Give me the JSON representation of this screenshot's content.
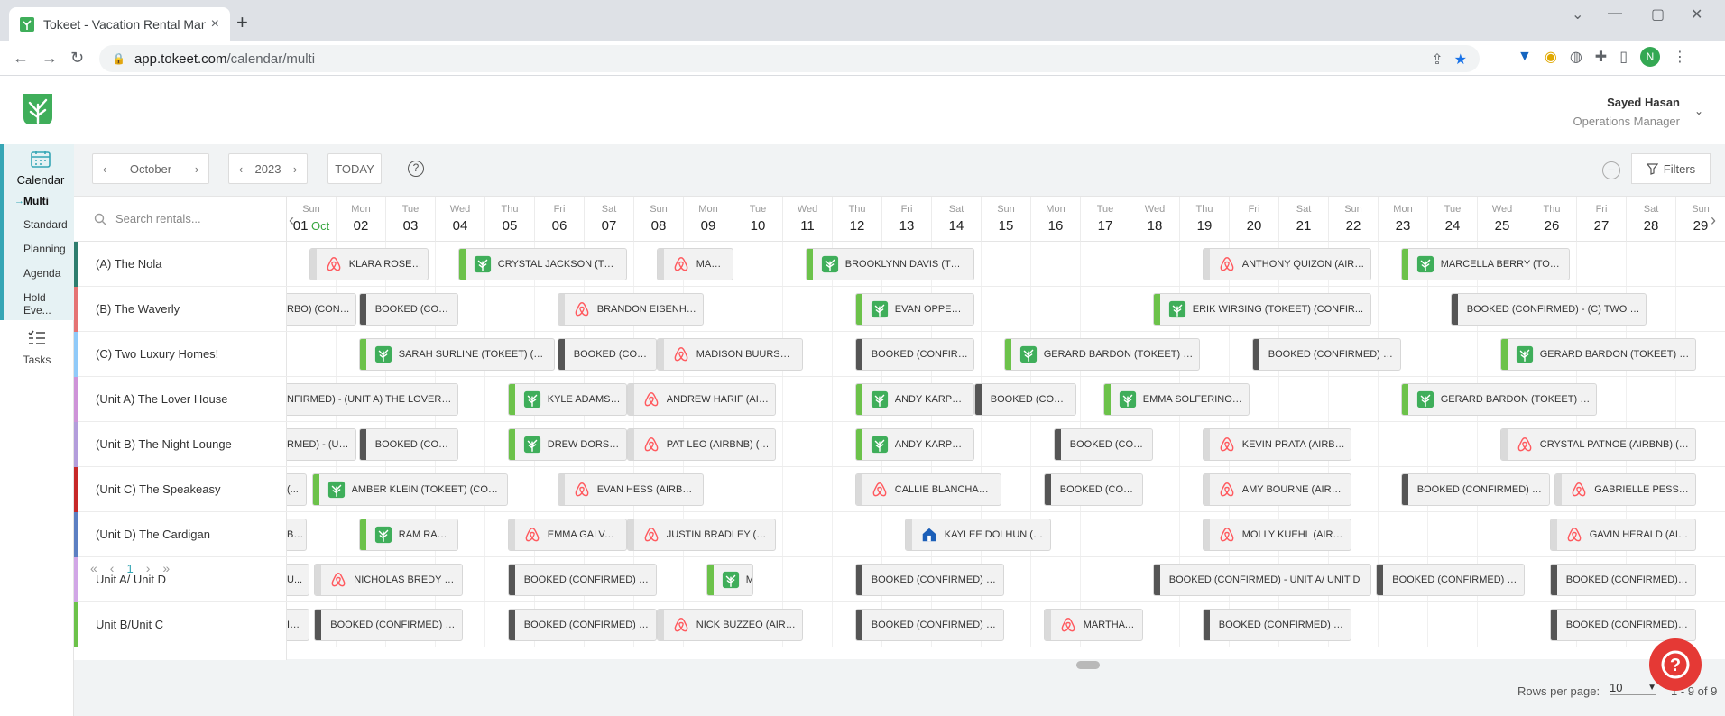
{
  "browser": {
    "tab_title": "Tokeet - Vacation Rental Manage",
    "tab_close": "×",
    "new_tab": "+",
    "url_host": "app.tokeet.com",
    "url_path": "/calendar/multi",
    "profile_initial": "N"
  },
  "header": {
    "user_name": "Sayed Hasan",
    "user_role": "Operations Manager"
  },
  "sidenav": {
    "calendar_label": "Calendar",
    "sub_items": [
      "Multi",
      "Standard",
      "Planning",
      "Agenda",
      "Hold Eve..."
    ],
    "tasks_label": "Tasks"
  },
  "toolbar": {
    "month": "October",
    "year": "2023",
    "today": "TODAY",
    "help": "?",
    "filters": "Filters"
  },
  "search": {
    "placeholder": "Search rentals..."
  },
  "days": [
    {
      "wd": "Sun",
      "dn": "01",
      "mo": "Oct"
    },
    {
      "wd": "Mon",
      "dn": "02"
    },
    {
      "wd": "Tue",
      "dn": "03"
    },
    {
      "wd": "Wed",
      "dn": "04"
    },
    {
      "wd": "Thu",
      "dn": "05"
    },
    {
      "wd": "Fri",
      "dn": "06"
    },
    {
      "wd": "Sat",
      "dn": "07"
    },
    {
      "wd": "Sun",
      "dn": "08"
    },
    {
      "wd": "Mon",
      "dn": "09"
    },
    {
      "wd": "Tue",
      "dn": "10"
    },
    {
      "wd": "Wed",
      "dn": "11"
    },
    {
      "wd": "Thu",
      "dn": "12"
    },
    {
      "wd": "Fri",
      "dn": "13"
    },
    {
      "wd": "Sat",
      "dn": "14"
    },
    {
      "wd": "Sun",
      "dn": "15"
    },
    {
      "wd": "Mon",
      "dn": "16"
    },
    {
      "wd": "Tue",
      "dn": "17"
    },
    {
      "wd": "Wed",
      "dn": "18"
    },
    {
      "wd": "Thu",
      "dn": "19"
    },
    {
      "wd": "Fri",
      "dn": "20"
    },
    {
      "wd": "Sat",
      "dn": "21"
    },
    {
      "wd": "Sun",
      "dn": "22"
    },
    {
      "wd": "Mon",
      "dn": "23"
    },
    {
      "wd": "Tue",
      "dn": "24"
    },
    {
      "wd": "Wed",
      "dn": "25"
    },
    {
      "wd": "Thu",
      "dn": "26"
    },
    {
      "wd": "Fri",
      "dn": "27"
    },
    {
      "wd": "Sat",
      "dn": "28"
    },
    {
      "wd": "Sun",
      "dn": "29"
    }
  ],
  "rentals": [
    {
      "name": "(A) The Nola",
      "color": "#2e7d6e"
    },
    {
      "name": "(B) The Waverly",
      "color": "#e57373"
    },
    {
      "name": "(C) Two Luxury Homes!",
      "color": "#90caf9"
    },
    {
      "name": "(Unit A) The Lover House",
      "color": "#ce93d8"
    },
    {
      "name": "(Unit B) The Night Lounge",
      "color": "#b39ddb"
    },
    {
      "name": "(Unit C) The Speakeasy",
      "color": "#c62828"
    },
    {
      "name": "(Unit D) The Cardigan",
      "color": "#5c7fc2"
    },
    {
      "name": "Unit A/ Unit D",
      "color": "#d1a6e6"
    },
    {
      "name": "Unit B/Unit C",
      "color": "#6cc24a"
    }
  ],
  "bookings": [
    [
      {
        "start": 0.45,
        "end": 2.85,
        "src": "airbnb",
        "text": "KLARA ROSENBERG (..."
      },
      {
        "start": 3.45,
        "end": 6.85,
        "src": "tokeet",
        "text": "CRYSTAL JACKSON (TOKEET) (C..."
      },
      {
        "start": 7.45,
        "end": 9.0,
        "src": "airbnb",
        "text": "MARTHA B..."
      },
      {
        "start": 10.45,
        "end": 13.85,
        "src": "tokeet",
        "text": "BROOKLYNN DAVIS (TOKEET) (C..."
      },
      {
        "start": 18.45,
        "end": 21.85,
        "src": "airbnb",
        "text": "ANTHONY QUIZON (AIRBNB) (CO..."
      },
      {
        "start": 22.45,
        "end": 25.85,
        "src": "tokeet",
        "text": "MARCELLA BERRY (TOKEET) (CO..."
      }
    ],
    [
      {
        "start": -0.2,
        "end": 1.4,
        "src": "none",
        "edge": "none",
        "text": "RBO) (CONFI..."
      },
      {
        "start": 1.45,
        "end": 3.45,
        "src": "none",
        "edge": "dark",
        "text": "BOOKED (CONFI..."
      },
      {
        "start": 5.45,
        "end": 8.4,
        "src": "airbnb",
        "text": "BRANDON EISENHAR..."
      },
      {
        "start": 11.45,
        "end": 13.85,
        "src": "tokeet",
        "text": "EVAN OPPENHEIMER ..."
      },
      {
        "start": 17.45,
        "end": 21.85,
        "src": "tokeet",
        "text": "ERIK WIRSING (TOKEET) (CONFIR..."
      },
      {
        "start": 23.45,
        "end": 27.4,
        "src": "none",
        "edge": "dark",
        "text": "BOOKED (CONFIRMED) - (C) TWO LUX..."
      }
    ],
    [
      {
        "start": 1.45,
        "end": 5.4,
        "src": "tokeet",
        "text": "SARAH SURLINE (TOKEET) (CON..."
      },
      {
        "start": 5.45,
        "end": 7.45,
        "src": "none",
        "edge": "dark",
        "text": "BOOKED (CONFI..."
      },
      {
        "start": 7.45,
        "end": 10.4,
        "src": "airbnb",
        "text": "MADISON BUURSMA (..."
      },
      {
        "start": 11.45,
        "end": 13.85,
        "src": "none",
        "edge": "dark",
        "text": "BOOKED (CONFIRMED) - (C..."
      },
      {
        "start": 14.45,
        "end": 18.4,
        "src": "tokeet",
        "text": "GERARD BARDON (TOKEET) (CO..."
      },
      {
        "start": 19.45,
        "end": 22.45,
        "src": "none",
        "edge": "dark",
        "text": "BOOKED (CONFIRMED) - (C..."
      },
      {
        "start": 24.45,
        "end": 28.4,
        "src": "tokeet",
        "text": "GERARD BARDON (TOKEET) (CO..."
      }
    ],
    [
      {
        "start": -0.2,
        "end": 3.45,
        "src": "none",
        "edge": "none",
        "text": "NFIRMED) - (UNIT A) THE LOVER HO..."
      },
      {
        "start": 4.45,
        "end": 6.85,
        "src": "tokeet",
        "text": "KYLE ADAMS (TOKEE..."
      },
      {
        "start": 6.85,
        "end": 9.85,
        "src": "airbnb",
        "text": "ANDREW HARIF (AIRB..."
      },
      {
        "start": 11.45,
        "end": 13.85,
        "src": "tokeet",
        "text": "ANDY KARPEL (TOKE..."
      },
      {
        "start": 13.85,
        "end": 15.9,
        "src": "none",
        "edge": "dark",
        "text": "BOOKED (CONFI..."
      },
      {
        "start": 16.45,
        "end": 19.4,
        "src": "tokeet",
        "text": "EMMA SOLFERINO (T..."
      },
      {
        "start": 22.45,
        "end": 26.4,
        "src": "tokeet",
        "text": "GERARD BARDON (TOKEET) (CO..."
      }
    ],
    [
      {
        "start": -0.2,
        "end": 1.4,
        "src": "none",
        "edge": "none",
        "text": "RMED) - (UNI..."
      },
      {
        "start": 1.45,
        "end": 3.45,
        "src": "none",
        "edge": "dark",
        "text": "BOOKED (CONFI..."
      },
      {
        "start": 4.45,
        "end": 6.85,
        "src": "tokeet",
        "text": "DREW DORSY (TOKEE..."
      },
      {
        "start": 6.85,
        "end": 9.85,
        "src": "airbnb",
        "text": "PAT LEO (AIRBNB) (C..."
      },
      {
        "start": 11.45,
        "end": 13.85,
        "src": "tokeet",
        "text": "ANDY KARPEL (TOKE..."
      },
      {
        "start": 15.45,
        "end": 17.45,
        "src": "none",
        "edge": "dark",
        "text": "BOOKED (CONFI..."
      },
      {
        "start": 18.45,
        "end": 21.45,
        "src": "airbnb",
        "text": "KEVIN PRATA (AIRBN..."
      },
      {
        "start": 24.45,
        "end": 28.4,
        "src": "airbnb",
        "text": "CRYSTAL PATNOE (AIRBNB) (CO..."
      }
    ],
    [
      {
        "start": -0.2,
        "end": 0.4,
        "src": "none",
        "edge": "none",
        "text": "(..."
      },
      {
        "start": 0.5,
        "end": 4.45,
        "src": "tokeet",
        "text": "AMBER KLEIN (TOKEET) (CONFIR..."
      },
      {
        "start": 5.45,
        "end": 8.4,
        "src": "airbnb",
        "text": "EVAN HESS (AIRBNB) ..."
      },
      {
        "start": 11.45,
        "end": 14.4,
        "src": "airbnb",
        "text": "CALLIE BLANCHARD (..."
      },
      {
        "start": 15.25,
        "end": 17.25,
        "src": "none",
        "edge": "dark",
        "text": "BOOKED (CONFI..."
      },
      {
        "start": 18.45,
        "end": 21.45,
        "src": "airbnb",
        "text": "AMY BOURNE (AIRBN..."
      },
      {
        "start": 22.45,
        "end": 25.45,
        "src": "none",
        "edge": "dark",
        "text": "BOOKED (CONFIRMED) - (C..."
      },
      {
        "start": 25.55,
        "end": 28.4,
        "src": "airbnb",
        "text": "GABRIELLE PESSON (..."
      }
    ],
    [
      {
        "start": -0.2,
        "end": 0.4,
        "src": "none",
        "edge": "none",
        "text": "B..."
      },
      {
        "start": 1.45,
        "end": 3.45,
        "src": "tokeet",
        "text": "RAM RAM..."
      },
      {
        "start": 4.45,
        "end": 6.85,
        "src": "airbnb",
        "text": "EMMA GALVAN (AIRB..."
      },
      {
        "start": 6.85,
        "end": 9.85,
        "src": "airbnb",
        "text": "JUSTIN BRADLEY (AI..."
      },
      {
        "start": 12.45,
        "end": 15.4,
        "src": "vrbo",
        "text": "KAYLEE DOLHUN (VR..."
      },
      {
        "start": 18.45,
        "end": 21.45,
        "src": "airbnb",
        "text": "MOLLY KUEHL (AIRBN..."
      },
      {
        "start": 25.45,
        "end": 28.4,
        "src": "airbnb",
        "text": "GAVIN HERALD (AIRB..."
      }
    ],
    [
      {
        "start": -0.2,
        "end": 0.45,
        "src": "none",
        "edge": "none",
        "text": "U..."
      },
      {
        "start": 0.55,
        "end": 3.55,
        "src": "airbnb",
        "text": "NICHOLAS BREDY (AI..."
      },
      {
        "start": 4.45,
        "end": 7.45,
        "src": "none",
        "edge": "dark",
        "text": "BOOKED (CONFIRMED) - U..."
      },
      {
        "start": 8.45,
        "end": 9.4,
        "src": "tokeet",
        "text": "M"
      },
      {
        "start": 11.45,
        "end": 14.45,
        "src": "none",
        "edge": "dark",
        "text": "BOOKED (CONFIRMED) - U..."
      },
      {
        "start": 17.45,
        "end": 21.85,
        "src": "none",
        "edge": "dark",
        "text": "BOOKED (CONFIRMED) - UNIT A/ UNIT D"
      },
      {
        "start": 21.95,
        "end": 24.95,
        "src": "none",
        "edge": "dark",
        "text": "BOOKED (CONFIRMED) - (C..."
      },
      {
        "start": 25.45,
        "end": 28.4,
        "src": "none",
        "edge": "dark",
        "text": "BOOKED (CONFIRMED) - U..."
      }
    ],
    [
      {
        "start": -0.2,
        "end": 0.45,
        "src": "none",
        "edge": "none",
        "text": "IT ..."
      },
      {
        "start": 0.55,
        "end": 3.55,
        "src": "none",
        "edge": "dark",
        "text": "BOOKED (CONFIRMED) - U..."
      },
      {
        "start": 4.45,
        "end": 7.45,
        "src": "none",
        "edge": "dark",
        "text": "BOOKED (CONFIRMED) - U..."
      },
      {
        "start": 7.45,
        "end": 10.4,
        "src": "airbnb",
        "text": "NICK BUZZEO (AIRBN..."
      },
      {
        "start": 11.45,
        "end": 14.45,
        "src": "none",
        "edge": "dark",
        "text": "BOOKED (CONFIRMED) - U..."
      },
      {
        "start": 15.25,
        "end": 17.25,
        "src": "airbnb",
        "text": "MARTHA B..."
      },
      {
        "start": 18.45,
        "end": 21.45,
        "src": "none",
        "edge": "dark",
        "text": "BOOKED (CONFIRMED) - U..."
      },
      {
        "start": 25.45,
        "end": 28.4,
        "src": "none",
        "edge": "dark",
        "text": "BOOKED (CONFIRMED) - U..."
      }
    ]
  ],
  "pagination": {
    "current_page": "1",
    "rows_label": "Rows per page:",
    "rows_value": "10",
    "range": "1 - 9 of 9"
  },
  "colors": {
    "accent": "#36a6b5",
    "tokeet_green": "#6cc24a",
    "dark_edge": "#555555",
    "airbnb": "#ff5a5f",
    "fab": "#e53935"
  }
}
